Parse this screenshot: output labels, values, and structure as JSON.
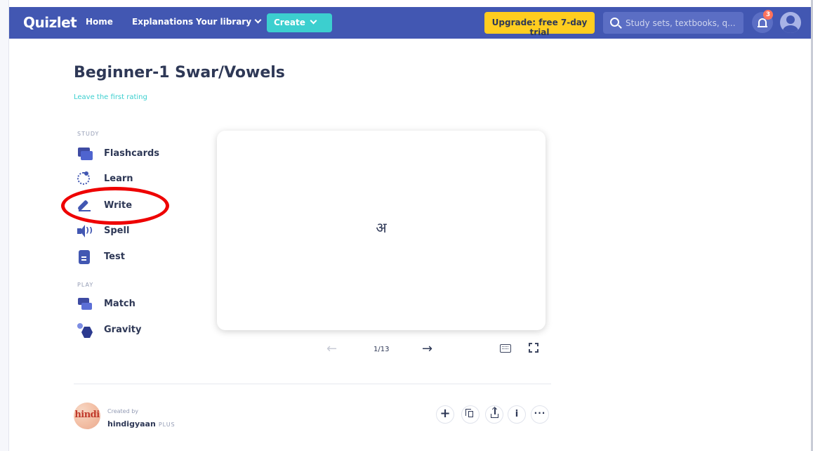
{
  "topbar": {
    "logo": "Quizlet",
    "nav": {
      "home": "Home",
      "explanations": "Explanations",
      "library": "Your library"
    },
    "create_label": "Create",
    "upgrade_label": "Upgrade: free 7-day trial",
    "search_placeholder": "Study sets, textbooks, q...",
    "notification_count": "3",
    "colors": {
      "bar": "#4257b2",
      "create": "#3ccfcf",
      "upgrade": "#ffcd1f"
    }
  },
  "set": {
    "title": "Beginner-1 Swar/Vowels",
    "rating_link": "Leave the first rating"
  },
  "study": {
    "section_label": "STUDY",
    "modes": [
      {
        "label": "Flashcards",
        "icon": "flashcards-icon"
      },
      {
        "label": "Learn",
        "icon": "learn-icon"
      },
      {
        "label": "Write",
        "icon": "write-icon"
      },
      {
        "label": "Spell",
        "icon": "spell-icon"
      },
      {
        "label": "Test",
        "icon": "test-icon"
      }
    ]
  },
  "play": {
    "section_label": "PLAY",
    "modes": [
      {
        "label": "Match",
        "icon": "match-icon"
      },
      {
        "label": "Gravity",
        "icon": "gravity-icon"
      }
    ]
  },
  "flashcard": {
    "term": "अ",
    "counter": "1/13"
  },
  "creator": {
    "created_by_label": "Created by",
    "name": "hindigyaan",
    "badge": "PLUS",
    "avatar_text": "hindi"
  },
  "actions": {
    "add": "+",
    "info": "i",
    "more": "···"
  }
}
